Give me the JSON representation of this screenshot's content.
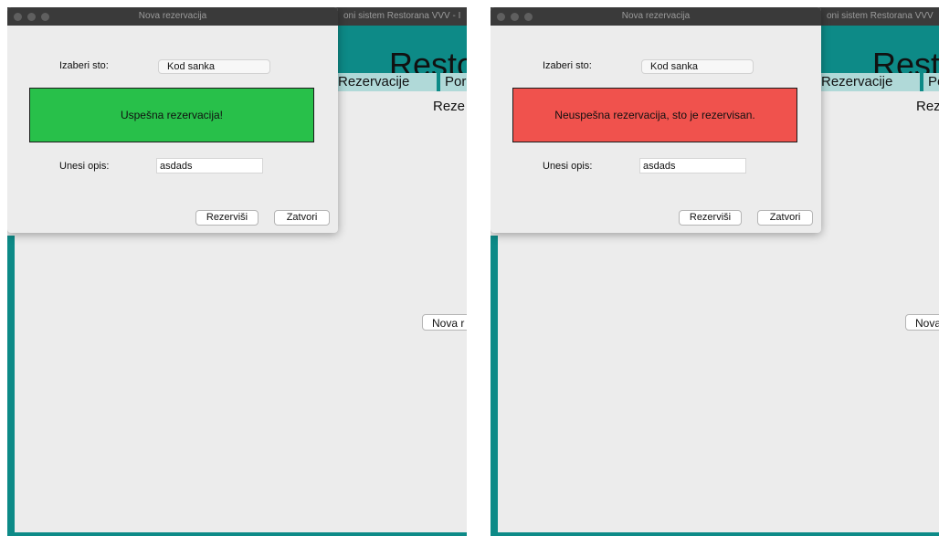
{
  "colors": {
    "teal": "#0d8a87",
    "menu_bg": "#b0d9d8",
    "success": "#28c04a",
    "error": "#f0524d"
  },
  "main_window": {
    "title": "oni sistem Restorana VVV - I",
    "brand": "Restor",
    "menu": {
      "rezervacije": "Rezervacije",
      "porudzbine": "Por"
    },
    "content_title": "Reze",
    "new_button": "Nova r"
  },
  "main_window_right": {
    "title": "oni sistem Restorana VVV",
    "brand": "Resto",
    "menu": {
      "rezervacije": "Rezervacije",
      "porudzbine": "Po"
    },
    "content_title": "Rez",
    "new_button": "Nova"
  },
  "dialogs": [
    {
      "title": "Nova rezervacija",
      "table_label": "Izaberi sto:",
      "table_value": "Kod sanka",
      "status_message": "Uspešna rezervacija!",
      "description_label": "Unesi opis:",
      "description_value": "asdads",
      "reserve_button": "Rezerviši",
      "close_button": "Zatvori"
    },
    {
      "title": "Nova rezervacija",
      "table_label": "Izaberi sto:",
      "table_value": "Kod sanka",
      "status_message": "Neuspešna rezervacija, sto je rezervisan.",
      "description_label": "Unesi opis:",
      "description_value": "asdads",
      "reserve_button": "Rezerviši",
      "close_button": "Zatvori"
    }
  ]
}
